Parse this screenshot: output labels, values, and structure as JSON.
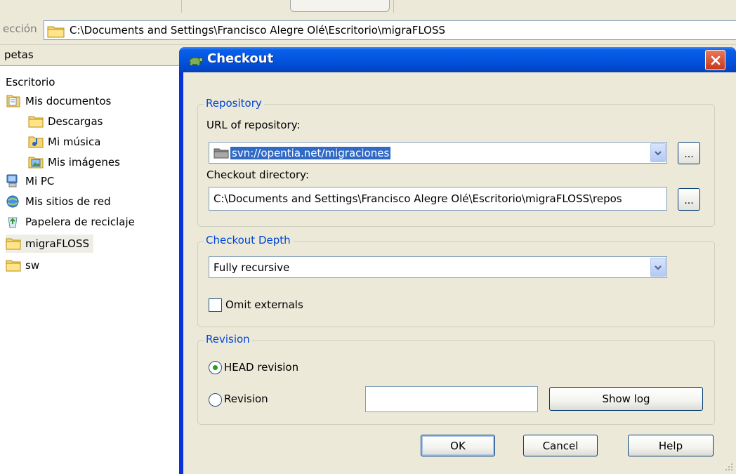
{
  "explorer": {
    "address_label": "ección",
    "address_path": "C:\\Documents and Settings\\Francisco Alegre Olé\\Escritorio\\migraFLOSS",
    "folders_header": "petas",
    "tree": [
      {
        "label": "Escritorio",
        "icon": "none"
      },
      {
        "label": "Mis documentos",
        "icon": "documents-folder-icon"
      },
      {
        "label": "Descargas",
        "icon": "folder-icon"
      },
      {
        "label": "Mi música",
        "icon": "music-folder-icon"
      },
      {
        "label": "Mis imágenes",
        "icon": "pictures-folder-icon"
      },
      {
        "label": "Mi PC",
        "icon": "computer-icon"
      },
      {
        "label": "Mis sitios de red",
        "icon": "network-icon"
      },
      {
        "label": "Papelera de reciclaje",
        "icon": "recycle-bin-icon"
      },
      {
        "label": "migraFLOSS",
        "icon": "folder-icon",
        "selected": true
      },
      {
        "label": "sw",
        "icon": "folder-icon"
      }
    ]
  },
  "dialog": {
    "title": "Checkout",
    "repository": {
      "group_label": "Repository",
      "url_label": "URL of repository:",
      "url_value": "svn://opentia.net/migraciones",
      "browse_label": "...",
      "dir_label": "Checkout directory:",
      "dir_value": "C:\\Documents and Settings\\Francisco Alegre Olé\\Escritorio\\migraFLOSS\\repos",
      "dir_browse_label": "..."
    },
    "depth": {
      "group_label": "Checkout Depth",
      "selected": "Fully recursive",
      "omit_externals_label": "Omit externals",
      "omit_externals_checked": false
    },
    "revision": {
      "group_label": "Revision",
      "head_label": "HEAD revision",
      "revision_label": "Revision",
      "selected": "HEAD revision",
      "revision_value": "",
      "show_log_label": "Show log"
    },
    "buttons": {
      "ok": "OK",
      "cancel": "Cancel",
      "help": "Help"
    }
  },
  "colors": {
    "titlebar": "#0355e0",
    "group_label": "#0046d5",
    "selection": "#316ac5",
    "dialog_bg": "#ece9d8"
  }
}
